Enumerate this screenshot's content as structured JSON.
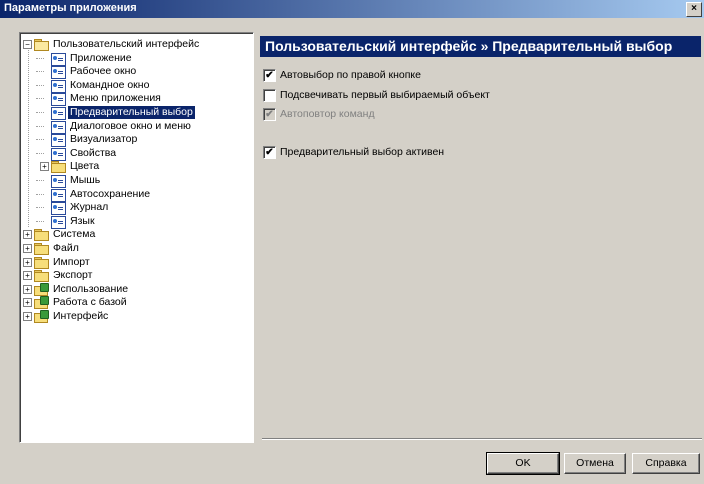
{
  "window": {
    "title": "Параметры приложения",
    "close_glyph": "×"
  },
  "tree": {
    "items": [
      {
        "label": "Пользовательский интерфейс",
        "level": 0,
        "icon": "folder-open-icon",
        "expander": "−",
        "selected": false
      },
      {
        "label": "Приложение",
        "level": 1,
        "icon": "settings-page-icon",
        "selected": false
      },
      {
        "label": "Рабочее окно",
        "level": 1,
        "icon": "settings-page-icon",
        "selected": false
      },
      {
        "label": "Командное окно",
        "level": 1,
        "icon": "settings-page-icon",
        "selected": false
      },
      {
        "label": "Меню приложения",
        "level": 1,
        "icon": "settings-page-icon",
        "selected": false
      },
      {
        "label": "Предварительный выбор",
        "level": 1,
        "icon": "settings-page-icon",
        "selected": true
      },
      {
        "label": "Диалоговое окно и меню",
        "level": 1,
        "icon": "settings-page-icon",
        "selected": false
      },
      {
        "label": "Визуализатор",
        "level": 1,
        "icon": "settings-page-icon",
        "selected": false
      },
      {
        "label": "Свойства",
        "level": 1,
        "icon": "settings-page-icon",
        "selected": false
      },
      {
        "label": "Цвета",
        "level": 1,
        "icon": "folder-icon",
        "expander": "+",
        "selected": false
      },
      {
        "label": "Мышь",
        "level": 1,
        "icon": "settings-page-icon",
        "selected": false
      },
      {
        "label": "Автосохранение",
        "level": 1,
        "icon": "settings-page-icon",
        "selected": false
      },
      {
        "label": "Журнал",
        "level": 1,
        "icon": "settings-page-icon",
        "selected": false
      },
      {
        "label": "Язык",
        "level": 1,
        "icon": "settings-page-icon",
        "selected": false
      },
      {
        "label": "Система",
        "level": 0,
        "icon": "folder-icon",
        "expander": "+",
        "selected": false
      },
      {
        "label": "Файл",
        "level": 0,
        "icon": "folder-icon",
        "expander": "+",
        "selected": false
      },
      {
        "label": "Импорт",
        "level": 0,
        "icon": "folder-icon",
        "expander": "+",
        "selected": false
      },
      {
        "label": "Экспорт",
        "level": 0,
        "icon": "folder-icon",
        "expander": "+",
        "selected": false
      },
      {
        "label": "Использование",
        "level": 0,
        "icon": "database-folder-icon",
        "expander": "+",
        "selected": false
      },
      {
        "label": "Работа с базой",
        "level": 0,
        "icon": "database-folder-icon",
        "expander": "+",
        "selected": false
      },
      {
        "label": "Интерфейс",
        "level": 0,
        "icon": "database-folder-icon",
        "expander": "+",
        "selected": false
      }
    ]
  },
  "panel": {
    "header": "Пользовательский интерфейс » Предварительный выбор",
    "options": [
      {
        "label": "Автовыбор по правой кнопке",
        "checked": true,
        "disabled": false
      },
      {
        "label": "Подсвечивать первый выбираемый объект",
        "checked": false,
        "disabled": false
      },
      {
        "label": "Автоповтор команд",
        "checked": true,
        "disabled": true
      },
      {
        "label": "Предварительный выбор активен",
        "checked": true,
        "disabled": false
      }
    ],
    "check_glyph": "✔"
  },
  "buttons": {
    "ok": "OK",
    "cancel": "Отмена",
    "help": "Справка"
  },
  "colors": {
    "selection": "#0a246a",
    "header_bg": "#0a246a",
    "dialog_bg": "#d4d0c8"
  }
}
